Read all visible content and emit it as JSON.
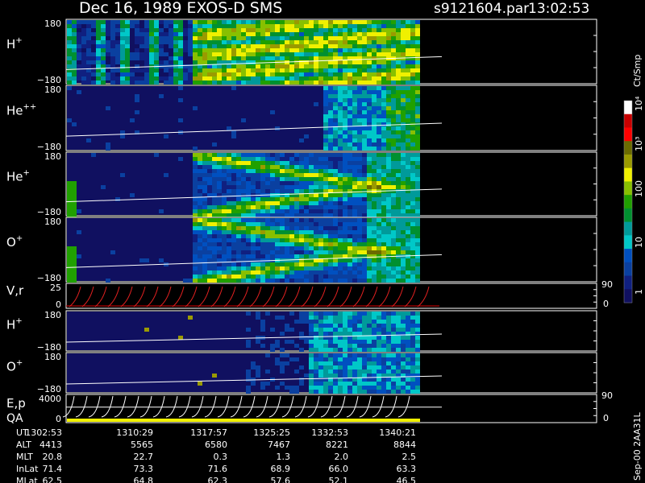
{
  "header": {
    "title": "Dec 16, 1989    EXOS-D SMS",
    "file": "s9121604.par",
    "time": "13:02:53"
  },
  "colorbar": {
    "unit": "Ct/Smp",
    "ticks": [
      "10⁴",
      "10³",
      "100",
      "10",
      "1"
    ],
    "colors": [
      "#ffffff",
      "#c80000",
      "#ff0000",
      "#6b6b00",
      "#9a9a00",
      "#f0f000",
      "#88c000",
      "#20a000",
      "#009030",
      "#009a9a",
      "#00c8c8",
      "#0050c0",
      "#0a40a0",
      "#102080",
      "#101060"
    ]
  },
  "panels": [
    {
      "label": "H",
      "sup": "+",
      "ytop": "180",
      "ybot": "−180"
    },
    {
      "label": "He",
      "sup": "++",
      "ytop": "180",
      "ybot": "−180"
    },
    {
      "label": "He",
      "sup": "+",
      "ytop": "180",
      "ybot": "−180"
    },
    {
      "label": "O",
      "sup": "+",
      "ytop": "180",
      "ybot": "−180"
    },
    {
      "label": "V,r",
      "sup": "",
      "ytop": "25",
      "ybot": "0",
      "rtop": "90",
      "rbot": "0"
    },
    {
      "label": "H",
      "sup": "+",
      "ytop": "180",
      "ybot": "−180"
    },
    {
      "label": "O",
      "sup": "+",
      "ytop": "180",
      "ybot": "−180"
    },
    {
      "label": "E,p",
      "sup": "",
      "label2": "QA",
      "ytop": "4000",
      "ybot": "0",
      "rtop": "90",
      "rbot": "0"
    }
  ],
  "ephemeris": {
    "rows": [
      {
        "name": "UT",
        "values": [
          "1302:53",
          "1310:29",
          "1317:57",
          "1325:25",
          "1332:53",
          "1340:21"
        ]
      },
      {
        "name": "ALT",
        "values": [
          "4413",
          "5565",
          "6580",
          "7467",
          "8221",
          "8844"
        ]
      },
      {
        "name": "MLT",
        "values": [
          "20.8",
          "22.7",
          "0.3",
          "1.3",
          "2.0",
          "2.5"
        ]
      },
      {
        "name": "InLat",
        "values": [
          "71.4",
          "73.3",
          "71.6",
          "68.9",
          "66.0",
          "63.3"
        ]
      },
      {
        "name": "MLat",
        "values": [
          "62.5",
          "64.8",
          "62.3",
          "57.6",
          "52.1",
          "46.5"
        ]
      }
    ]
  },
  "footer": {
    "stamp": "Sep-00  2AA31L"
  },
  "chart_data": {
    "type": "heatmap",
    "title": "Dec 16, 1989    EXOS-D SMS",
    "x_ticks": [
      "1302:53",
      "1310:29",
      "1317:57",
      "1325:25",
      "1332:53",
      "1340:21"
    ],
    "panels": [
      "H+",
      "He++",
      "He+",
      "O+",
      "V,r",
      "H+",
      "O+",
      "E,p / QA"
    ],
    "ylim": [
      -180,
      180
    ],
    "colorbar_range": [
      1,
      10000
    ],
    "colorbar_scale": "log",
    "colorbar_label": "Ct/Smp"
  }
}
